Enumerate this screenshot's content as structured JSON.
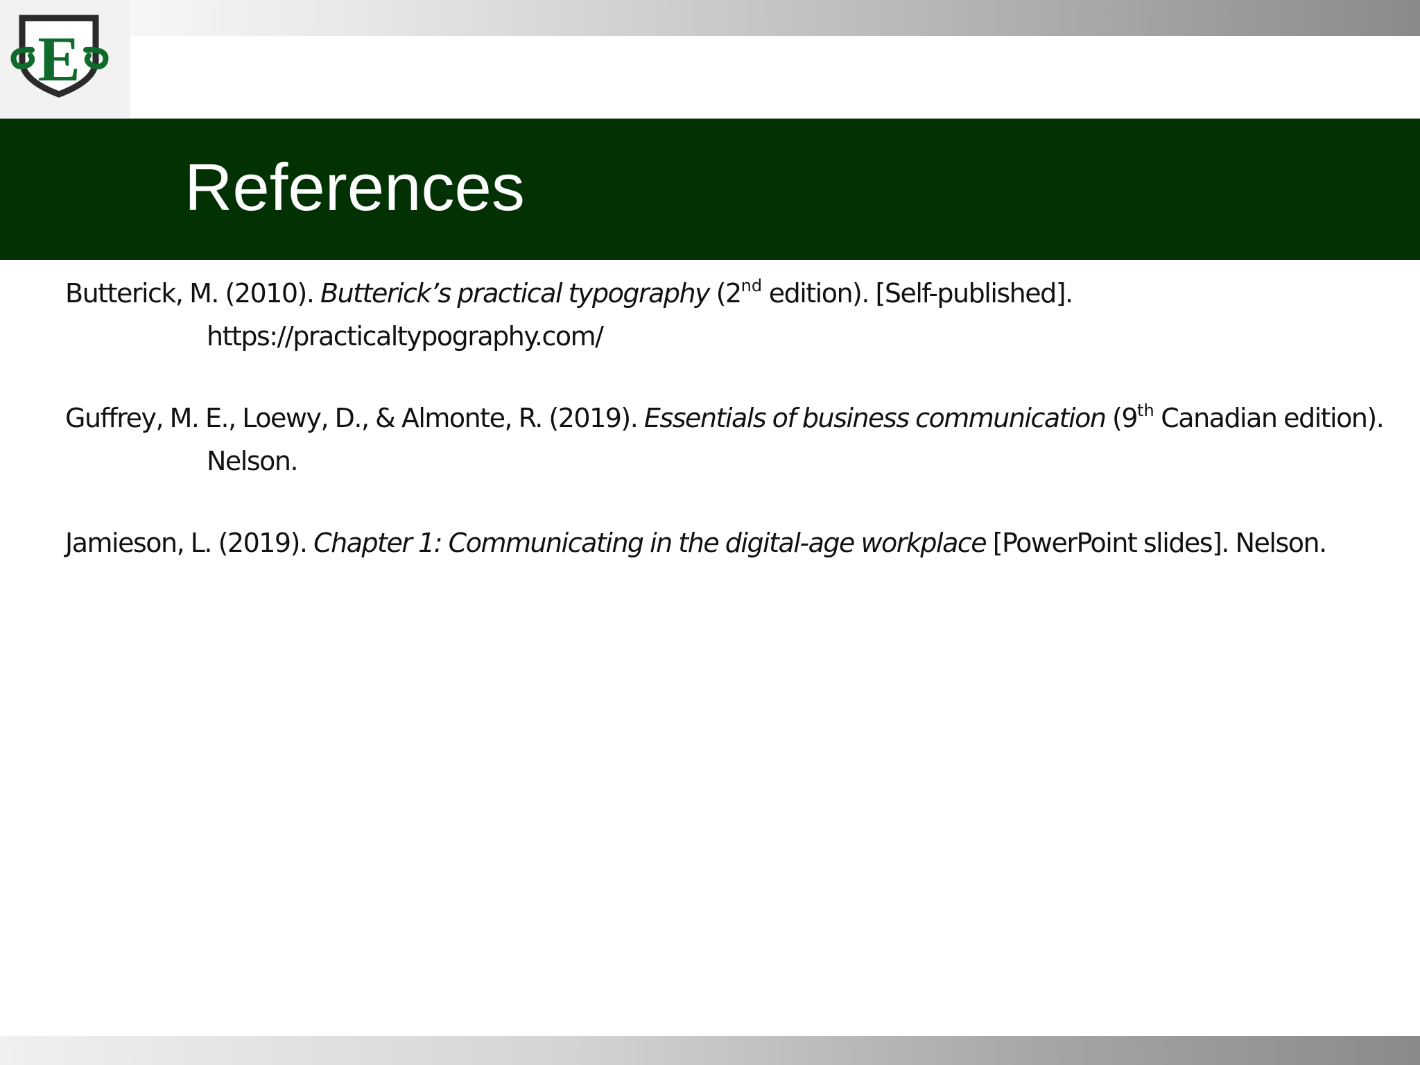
{
  "slide": {
    "logo_letter": "E",
    "title": "References"
  },
  "references": [
    {
      "lead": "Butterick, M. (2010). ",
      "italic": "Butterick’s practical typography",
      "mid": " (2",
      "sup": "nd",
      "tail": " edition). [Self-published]. https://practicaltypography.com/"
    },
    {
      "lead": "Guffrey, M. E., Loewy, D., & Almonte, R. (2019). ",
      "italic": "Essentials of business communication",
      "mid": " (9",
      "sup": "th",
      "tail": " Canadian edition). Nelson."
    },
    {
      "lead": "Jamieson, L. (2019). ",
      "italic": "Chapter 1: Communicating in the digital-age workplace",
      "mid": " [PowerPoint slides]. Nelson.",
      "sup": "",
      "tail": ""
    }
  ],
  "colors": {
    "title_bar": "#023104",
    "title_text": "#ffffff",
    "logo_green": "#0f6b2c",
    "logo_shield": "#2b2b2b"
  },
  "icons": {
    "logo": "school-crest-logo-icon"
  }
}
